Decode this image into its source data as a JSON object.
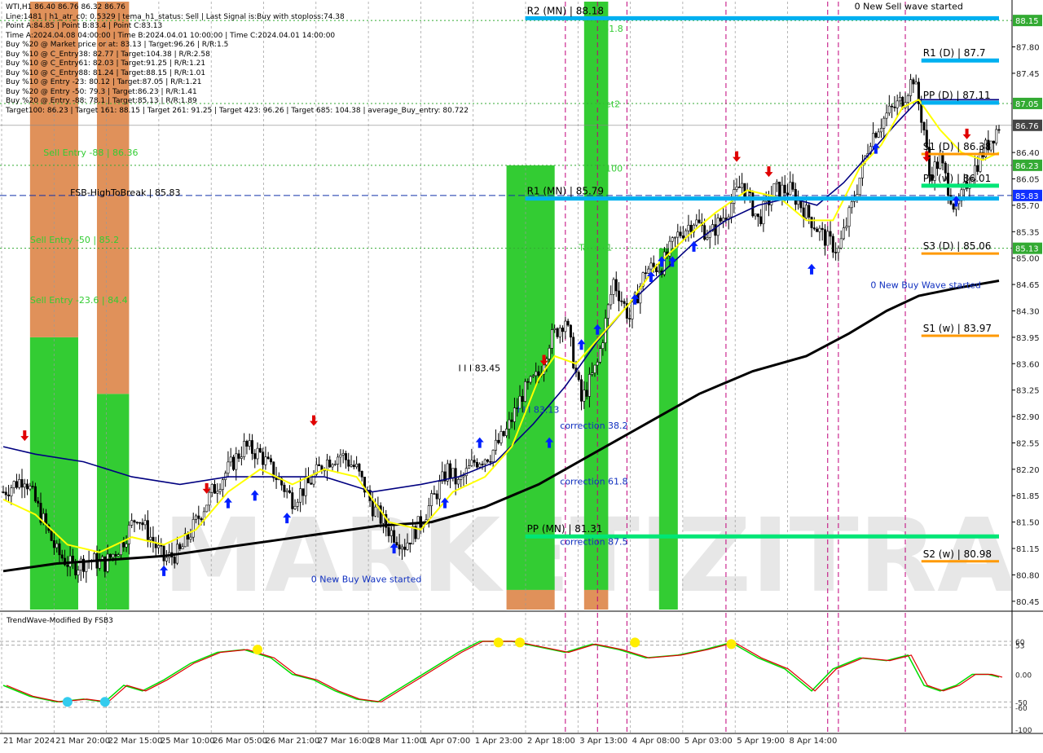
{
  "colors": {
    "background": "#ffffff",
    "candle": "#000000",
    "ema_short": "#ffff00",
    "ema_mid": "#000080",
    "ema_long": "#000000",
    "zone_green": "#33cc33",
    "zone_orange": "#e0915a",
    "level_cyan": "#00b0f0",
    "level_green": "#00e676",
    "level_orange": "#ff9900",
    "buy_arrow": "#0020ff",
    "sell_arrow": "#e00000",
    "osc_green": "#00dd00",
    "osc_red": "#dd0000",
    "tag_green": "#33aa33",
    "tag_blue": "#1030ff"
  },
  "header": {
    "lines": [
      "WTI,H1  86.40 86.76 86.32 86.76",
      "Line:1481  |  h1_atr_c0: 0.5329  |  tema_h1_status: Sell  |  Last Signal is:Buy with stoploss:74.38",
      "Point A:84.85  |  Point B:83.4  |  Point C:83.13",
      "Time A:2024.04.08 04:00:00  |  Time B:2024.04.01 10:00:00  |  Time C:2024.04.01 14:00:00",
      "Buy %20 @ Market price or at: 83.13  |  Target:96.26  |  R/R:1.5",
      "Buy %10 @ C_Entry38: 82.77  |  Target:104.38  |  R/R:2.58",
      "Buy %10 @ C_Entry61: 82.03  |  Target:91.25  |  R/R:1.21",
      "Buy %10 @ C_Entry88: 81.24  |  Target:88.15  |  R/R:1.01",
      "Buy %10 @ Entry -23: 80.12  |  Target:87.05  |  R/R:1.21",
      "Buy %20 @ Entry -50: 79.3  |  Target:86.23  |  R/R:1.41",
      "Buy %20 @ Entry -88: 78.1  |  Target:85.13  |  R/R:1.89",
      "Target100: 86.23  |  Target 161: 88.15  |  Target 261: 91.25  |  Target 423: 96.26  |  Target 685: 104.38  |  average_Buy_entry: 80.722"
    ]
  },
  "watermark": "MARKETIZITRADE",
  "chart_data": {
    "type": "candlestick",
    "symbol": "WTI",
    "timeframe": "H1",
    "ohlc_last": [
      86.4,
      86.76,
      86.32,
      86.76
    ],
    "ylim": [
      80.34,
      88.4
    ],
    "y_ticks": [
      "88.15",
      "87.80",
      "87.45",
      "87.05",
      "86.76",
      "86.40",
      "86.23",
      "86.05",
      "85.83",
      "85.70",
      "85.35",
      "85.13",
      "85.00",
      "84.65",
      "84.30",
      "83.95",
      "83.60",
      "83.25",
      "82.90",
      "82.55",
      "82.20",
      "81.85",
      "81.50",
      "81.15",
      "80.80",
      "80.45"
    ],
    "price_tags": [
      {
        "label": "88.15",
        "value": 88.15,
        "color": "green"
      },
      {
        "label": "87.05",
        "value": 87.05,
        "color": "green"
      },
      {
        "label": "86.76",
        "value": 86.76,
        "color": "gray"
      },
      {
        "label": "86.23",
        "value": 86.23,
        "color": "green"
      },
      {
        "label": "85.83",
        "value": 85.83,
        "color": "blue"
      },
      {
        "label": "85.13",
        "value": 85.13,
        "color": "green"
      }
    ],
    "x_labels": [
      "21 Mar 2024",
      "21 Mar 20:00",
      "22 Mar 15:00",
      "25 Mar 10:00",
      "26 Mar 05:00",
      "26 Mar 21:00",
      "27 Mar 16:00",
      "28 Mar 11:00",
      "1 Apr 07:00",
      "1 Apr 23:00",
      "2 Apr 18:00",
      "3 Apr 13:00",
      "4 Apr 08:00",
      "5 Apr 03:00",
      "5 Apr 19:00",
      "8 Apr 14:00"
    ],
    "close_path": [
      [
        0,
        81.9
      ],
      [
        8,
        82.1
      ],
      [
        14,
        81.6
      ],
      [
        20,
        81.1
      ],
      [
        26,
        80.9
      ],
      [
        32,
        81.0
      ],
      [
        38,
        80.95
      ],
      [
        44,
        81.2
      ],
      [
        50,
        81.6
      ],
      [
        55,
        81.3
      ],
      [
        60,
        81.0
      ],
      [
        66,
        81.1
      ],
      [
        72,
        81.5
      ],
      [
        78,
        81.9
      ],
      [
        84,
        82.2
      ],
      [
        90,
        82.5
      ],
      [
        96,
        82.4
      ],
      [
        102,
        82.1
      ],
      [
        108,
        81.8
      ],
      [
        114,
        82.0
      ],
      [
        120,
        82.3
      ],
      [
        126,
        82.4
      ],
      [
        132,
        82.2
      ],
      [
        138,
        81.7
      ],
      [
        144,
        81.4
      ],
      [
        150,
        81.2
      ],
      [
        156,
        81.5
      ],
      [
        162,
        81.9
      ],
      [
        166,
        82.2
      ],
      [
        170,
        82.0
      ],
      [
        176,
        82.3
      ],
      [
        182,
        82.4
      ],
      [
        188,
        82.7
      ],
      [
        194,
        83.2
      ],
      [
        200,
        83.45
      ],
      [
        204,
        83.9
      ],
      [
        210,
        84.2
      ],
      [
        216,
        83.1
      ],
      [
        222,
        83.6
      ],
      [
        228,
        84.7
      ],
      [
        234,
        84.2
      ],
      [
        240,
        84.85
      ],
      [
        246,
        84.9
      ],
      [
        252,
        85.3
      ],
      [
        258,
        85.5
      ],
      [
        264,
        85.3
      ],
      [
        270,
        85.6
      ],
      [
        276,
        86.0
      ],
      [
        282,
        85.5
      ],
      [
        288,
        85.9
      ],
      [
        294,
        85.9
      ],
      [
        300,
        85.6
      ],
      [
        306,
        85.3
      ],
      [
        312,
        85.1
      ],
      [
        318,
        85.8
      ],
      [
        324,
        86.6
      ],
      [
        330,
        86.9
      ],
      [
        336,
        87.1
      ],
      [
        340,
        87.4
      ],
      [
        344,
        86.7
      ],
      [
        346,
        86.1
      ],
      [
        350,
        86.3
      ],
      [
        356,
        85.6
      ],
      [
        360,
        86.0
      ],
      [
        366,
        86.4
      ],
      [
        372,
        86.76
      ]
    ],
    "ema_short": [
      [
        0,
        81.8
      ],
      [
        12,
        81.6
      ],
      [
        24,
        81.2
      ],
      [
        36,
        81.1
      ],
      [
        48,
        81.3
      ],
      [
        60,
        81.2
      ],
      [
        72,
        81.4
      ],
      [
        84,
        81.9
      ],
      [
        96,
        82.2
      ],
      [
        108,
        82.0
      ],
      [
        120,
        82.2
      ],
      [
        132,
        82.1
      ],
      [
        144,
        81.5
      ],
      [
        156,
        81.4
      ],
      [
        168,
        81.9
      ],
      [
        180,
        82.1
      ],
      [
        190,
        82.5
      ],
      [
        200,
        83.4
      ],
      [
        206,
        83.7
      ],
      [
        214,
        83.6
      ],
      [
        224,
        84.0
      ],
      [
        234,
        84.4
      ],
      [
        244,
        84.9
      ],
      [
        256,
        85.3
      ],
      [
        266,
        85.6
      ],
      [
        278,
        85.9
      ],
      [
        290,
        85.8
      ],
      [
        300,
        85.5
      ],
      [
        310,
        85.5
      ],
      [
        320,
        86.2
      ],
      [
        328,
        86.5
      ],
      [
        336,
        87.0
      ],
      [
        342,
        87.1
      ],
      [
        350,
        86.7
      ],
      [
        358,
        86.4
      ],
      [
        366,
        86.3
      ],
      [
        372,
        86.4
      ]
    ],
    "ema_mid": [
      [
        0,
        82.5
      ],
      [
        12,
        82.4
      ],
      [
        30,
        82.3
      ],
      [
        48,
        82.1
      ],
      [
        66,
        82.0
      ],
      [
        84,
        82.1
      ],
      [
        102,
        82.1
      ],
      [
        120,
        82.1
      ],
      [
        138,
        81.9
      ],
      [
        156,
        82.0
      ],
      [
        170,
        82.1
      ],
      [
        184,
        82.3
      ],
      [
        198,
        82.8
      ],
      [
        210,
        83.3
      ],
      [
        222,
        83.9
      ],
      [
        234,
        84.4
      ],
      [
        246,
        84.8
      ],
      [
        258,
        85.2
      ],
      [
        270,
        85.5
      ],
      [
        282,
        85.7
      ],
      [
        294,
        85.8
      ],
      [
        304,
        85.7
      ],
      [
        314,
        86.0
      ],
      [
        324,
        86.4
      ],
      [
        334,
        86.8
      ],
      [
        342,
        87.1
      ],
      [
        352,
        87.1
      ],
      [
        362,
        87.1
      ],
      [
        372,
        87.1
      ]
    ],
    "ema_long": [
      [
        0,
        80.85
      ],
      [
        20,
        80.95
      ],
      [
        40,
        81.0
      ],
      [
        60,
        81.05
      ],
      [
        80,
        81.15
      ],
      [
        100,
        81.25
      ],
      [
        120,
        81.35
      ],
      [
        140,
        81.45
      ],
      [
        160,
        81.5
      ],
      [
        180,
        81.7
      ],
      [
        200,
        82.0
      ],
      [
        220,
        82.4
      ],
      [
        240,
        82.8
      ],
      [
        260,
        83.2
      ],
      [
        280,
        83.5
      ],
      [
        300,
        83.7
      ],
      [
        316,
        84.0
      ],
      [
        330,
        84.3
      ],
      [
        342,
        84.5
      ],
      [
        356,
        84.6
      ],
      [
        372,
        84.7
      ]
    ],
    "levels": [
      {
        "label": "R2 (MN) | 88.18",
        "value": 88.18,
        "x0": 195,
        "x1": 372,
        "color": "cyan"
      },
      {
        "label": "R1 (MN) | 85.79",
        "value": 85.79,
        "x0": 195,
        "x1": 372,
        "color": "cyan"
      },
      {
        "label": "PP (MN) | 81.31",
        "value": 81.31,
        "x0": 195,
        "x1": 372,
        "color": "green"
      },
      {
        "label": "R1 (D) | 87.7",
        "value": 87.62,
        "x0": 343,
        "x1": 372,
        "color": "cyan"
      },
      {
        "label": "PP (D) | 87.11",
        "value": 87.06,
        "x0": 343,
        "x1": 372,
        "color": "cyan"
      },
      {
        "label": "S1 (D) | 86.38",
        "value": 86.38,
        "x0": 343,
        "x1": 372,
        "color": "orange"
      },
      {
        "label": "PP (w) | 86.01",
        "value": 85.96,
        "x0": 343,
        "x1": 372,
        "color": "green"
      },
      {
        "label": "S3 (D) | 85.06",
        "value": 85.06,
        "x0": 343,
        "x1": 372,
        "color": "orange"
      },
      {
        "label": "S1 (w) | 83.97",
        "value": 83.97,
        "x0": 343,
        "x1": 372,
        "color": "orange"
      },
      {
        "label": "S2 (w) | 80.98",
        "value": 80.98,
        "x0": 343,
        "x1": 372,
        "color": "orange"
      }
    ],
    "labels": [
      {
        "text": "Sell Entry -88 | 86.36",
        "t": 15,
        "value": 86.36,
        "color": "green"
      },
      {
        "text": "FSB-HighToBreak | 85.83",
        "t": 25,
        "value": 85.83,
        "color": "black"
      },
      {
        "text": "Sell Entry -50 | 85.2",
        "t": 10,
        "value": 85.2,
        "color": "green"
      },
      {
        "text": "Sell Entry -23.6 | 84.4",
        "t": 10,
        "value": 84.4,
        "color": "green"
      },
      {
        "text": "I I I 83.45",
        "t": 170,
        "value": 83.5,
        "color": "black"
      },
      {
        "text": "I I I 83.13",
        "t": 192,
        "value": 82.95,
        "color": "blue"
      },
      {
        "text": "correction 38.2",
        "t": 208,
        "value": 82.74,
        "color": "blue"
      },
      {
        "text": "correction 61.8",
        "t": 208,
        "value": 82.0,
        "color": "blue"
      },
      {
        "text": "correction 87.5",
        "t": 208,
        "value": 81.2,
        "color": "blue"
      },
      {
        "text": "0 New Buy Wave started",
        "t": 115,
        "value": 80.7,
        "color": "blue"
      },
      {
        "text": "0 New Buy Wave started",
        "t": 324,
        "value": 84.6,
        "color": "blue"
      },
      {
        "text": "0 New Sell wave started",
        "t": 318,
        "value": 88.3,
        "color": "black"
      },
      {
        "text": "161.8",
        "t": 222,
        "value": 88.0,
        "color": "green"
      },
      {
        "text": "Target2",
        "t": 218,
        "value": 87.0,
        "color": "green"
      },
      {
        "text": "100",
        "t": 225,
        "value": 86.15,
        "color": "green"
      },
      {
        "text": "Target1",
        "t": 215,
        "value": 85.1,
        "color": "green"
      }
    ],
    "buy_arrows": [
      [
        60,
        81.0
      ],
      [
        84,
        81.9
      ],
      [
        94,
        82.0
      ],
      [
        106,
        81.7
      ],
      [
        146,
        81.3
      ],
      [
        165,
        81.9
      ],
      [
        178,
        82.7
      ],
      [
        204,
        82.7
      ],
      [
        216,
        84.0
      ],
      [
        222,
        84.2
      ],
      [
        236,
        84.6
      ],
      [
        242,
        84.9
      ],
      [
        246,
        85.1
      ],
      [
        250,
        85.1
      ],
      [
        258,
        85.3
      ],
      [
        302,
        85.0
      ],
      [
        326,
        86.6
      ],
      [
        356,
        85.9
      ]
    ],
    "sell_arrows": [
      [
        8,
        82.5
      ],
      [
        76,
        81.8
      ],
      [
        116,
        82.7
      ],
      [
        202,
        83.5
      ],
      [
        274,
        86.2
      ],
      [
        286,
        86.0
      ],
      [
        345,
        86.2
      ],
      [
        360,
        86.5
      ]
    ],
    "zones": [
      {
        "t0": 10,
        "t1": 28,
        "y0": 80.34,
        "y1": 83.95,
        "color": "green"
      },
      {
        "t0": 10,
        "t1": 28,
        "y0": 83.95,
        "y1": 88.4,
        "color": "orange"
      },
      {
        "t0": 35,
        "t1": 47,
        "y0": 80.34,
        "y1": 83.2,
        "color": "green"
      },
      {
        "t0": 35,
        "t1": 47,
        "y0": 83.2,
        "y1": 88.4,
        "color": "orange"
      },
      {
        "t0": 188,
        "t1": 206,
        "y0": 80.6,
        "y1": 86.23,
        "color": "green"
      },
      {
        "t0": 188,
        "t1": 206,
        "y0": 80.34,
        "y1": 80.6,
        "color": "orange"
      },
      {
        "t0": 217,
        "t1": 226,
        "y0": 80.6,
        "y1": 88.4,
        "color": "green"
      },
      {
        "t0": 217,
        "t1": 226,
        "y0": 80.34,
        "y1": 80.6,
        "color": "orange"
      },
      {
        "t0": 245,
        "t1": 252,
        "y0": 80.34,
        "y1": 85.13,
        "color": "green"
      }
    ],
    "vlines_magenta": [
      210,
      222,
      233,
      270,
      308,
      312,
      337
    ],
    "oscillator": {
      "name": "TrendWave-Modified By FSB3",
      "ylim": [
        -100,
        100
      ],
      "y_ticks": [
        "60",
        "53",
        "0.00",
        "-50",
        "-60",
        "-100"
      ],
      "values": [
        [
          0,
          -20
        ],
        [
          10,
          -40
        ],
        [
          20,
          -50
        ],
        [
          30,
          -45
        ],
        [
          38,
          -50
        ],
        [
          45,
          -20
        ],
        [
          52,
          -30
        ],
        [
          60,
          -10
        ],
        [
          70,
          20
        ],
        [
          80,
          40
        ],
        [
          90,
          45
        ],
        [
          100,
          30
        ],
        [
          108,
          0
        ],
        [
          116,
          -10
        ],
        [
          124,
          -30
        ],
        [
          132,
          -45
        ],
        [
          140,
          -50
        ],
        [
          150,
          -20
        ],
        [
          160,
          10
        ],
        [
          170,
          40
        ],
        [
          178,
          60
        ],
        [
          190,
          60
        ],
        [
          200,
          50
        ],
        [
          210,
          40
        ],
        [
          220,
          55
        ],
        [
          230,
          45
        ],
        [
          240,
          30
        ],
        [
          252,
          35
        ],
        [
          262,
          45
        ],
        [
          272,
          58
        ],
        [
          282,
          30
        ],
        [
          292,
          10
        ],
        [
          302,
          -30
        ],
        [
          310,
          10
        ],
        [
          320,
          30
        ],
        [
          330,
          25
        ],
        [
          338,
          35
        ],
        [
          344,
          -20
        ],
        [
          350,
          -30
        ],
        [
          356,
          -20
        ],
        [
          362,
          0
        ],
        [
          368,
          0
        ],
        [
          372,
          -5
        ]
      ],
      "markers_yellow": [
        [
          185,
          58
        ],
        [
          193,
          58
        ],
        [
          236,
          58
        ],
        [
          272,
          55
        ],
        [
          95,
          45
        ]
      ],
      "markers_cyan": [
        [
          24,
          -50
        ],
        [
          38,
          -50
        ]
      ]
    }
  }
}
